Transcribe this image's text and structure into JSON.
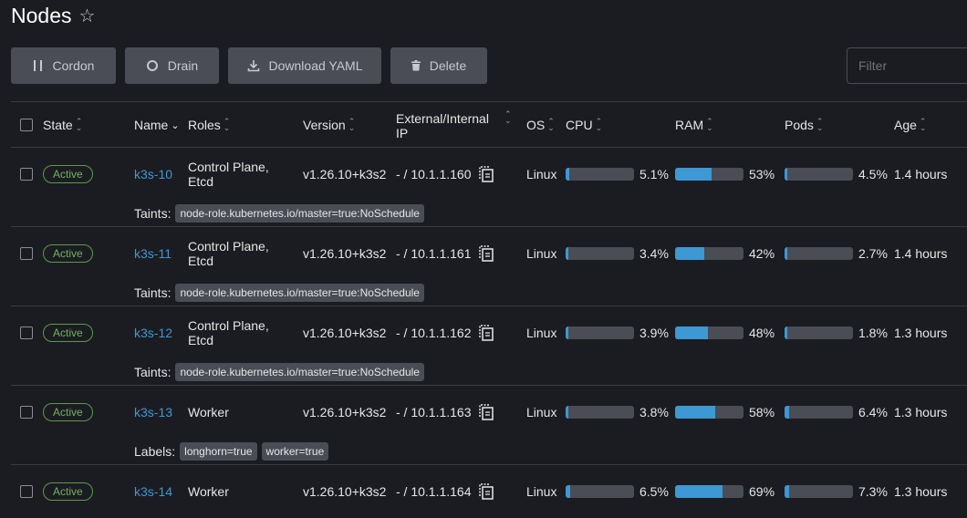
{
  "page": {
    "title": "Nodes"
  },
  "toolbar": {
    "cordon_label": "Cordon",
    "drain_label": "Drain",
    "download_label": "Download YAML",
    "delete_label": "Delete"
  },
  "filter": {
    "placeholder": "Filter",
    "value": ""
  },
  "columns": {
    "state": "State",
    "name": "Name",
    "roles": "Roles",
    "version": "Version",
    "ip_line1": "External/Internal",
    "ip_line2": "IP",
    "os": "OS",
    "cpu": "CPU",
    "ram": "RAM",
    "pods": "Pods",
    "age": "Age"
  },
  "colors": {
    "accent": "#3d98d3",
    "active": "#6fb35e",
    "background": "#1b1c21",
    "button": "#4a4d55"
  },
  "icons": {
    "star": "star-outline-icon",
    "cordon": "pause-icon",
    "drain": "circle-icon",
    "download": "download-icon",
    "delete": "trash-icon",
    "copy": "copy-icon"
  },
  "nodes": [
    {
      "state": "Active",
      "name": "k3s-10",
      "roles_line1": "Control Plane,",
      "roles_line2": "Etcd",
      "version": "v1.26.10+k3s2",
      "ip": "- / 10.1.1.160",
      "os": "Linux",
      "cpu": "5.1%",
      "cpu_value": 5.1,
      "ram": "53%",
      "ram_value": 53,
      "pods": "4.5%",
      "pods_value": 4.5,
      "age": "1.4 hours",
      "sub_label": "Taints:",
      "chips": [
        "node-role.kubernetes.io/master=true:NoSchedule"
      ]
    },
    {
      "state": "Active",
      "name": "k3s-11",
      "roles_line1": "Control Plane,",
      "roles_line2": "Etcd",
      "version": "v1.26.10+k3s2",
      "ip": "- / 10.1.1.161",
      "os": "Linux",
      "cpu": "3.4%",
      "cpu_value": 3.4,
      "ram": "42%",
      "ram_value": 42,
      "pods": "2.7%",
      "pods_value": 2.7,
      "age": "1.4 hours",
      "sub_label": "Taints:",
      "chips": [
        "node-role.kubernetes.io/master=true:NoSchedule"
      ]
    },
    {
      "state": "Active",
      "name": "k3s-12",
      "roles_line1": "Control Plane,",
      "roles_line2": "Etcd",
      "version": "v1.26.10+k3s2",
      "ip": "- / 10.1.1.162",
      "os": "Linux",
      "cpu": "3.9%",
      "cpu_value": 3.9,
      "ram": "48%",
      "ram_value": 48,
      "pods": "1.8%",
      "pods_value": 1.8,
      "age": "1.3 hours",
      "sub_label": "Taints:",
      "chips": [
        "node-role.kubernetes.io/master=true:NoSchedule"
      ]
    },
    {
      "state": "Active",
      "name": "k3s-13",
      "roles_line1": "Worker",
      "roles_line2": "",
      "version": "v1.26.10+k3s2",
      "ip": "- / 10.1.1.163",
      "os": "Linux",
      "cpu": "3.8%",
      "cpu_value": 3.8,
      "ram": "58%",
      "ram_value": 58,
      "pods": "6.4%",
      "pods_value": 6.4,
      "age": "1.3 hours",
      "sub_label": "Labels:",
      "chips": [
        "longhorn=true",
        "worker=true"
      ]
    },
    {
      "state": "Active",
      "name": "k3s-14",
      "roles_line1": "Worker",
      "roles_line2": "",
      "version": "v1.26.10+k3s2",
      "ip": "- / 10.1.1.164",
      "os": "Linux",
      "cpu": "6.5%",
      "cpu_value": 6.5,
      "ram": "69%",
      "ram_value": 69,
      "pods": "7.3%",
      "pods_value": 7.3,
      "age": "1.3 hours",
      "sub_label": "",
      "chips": []
    }
  ]
}
